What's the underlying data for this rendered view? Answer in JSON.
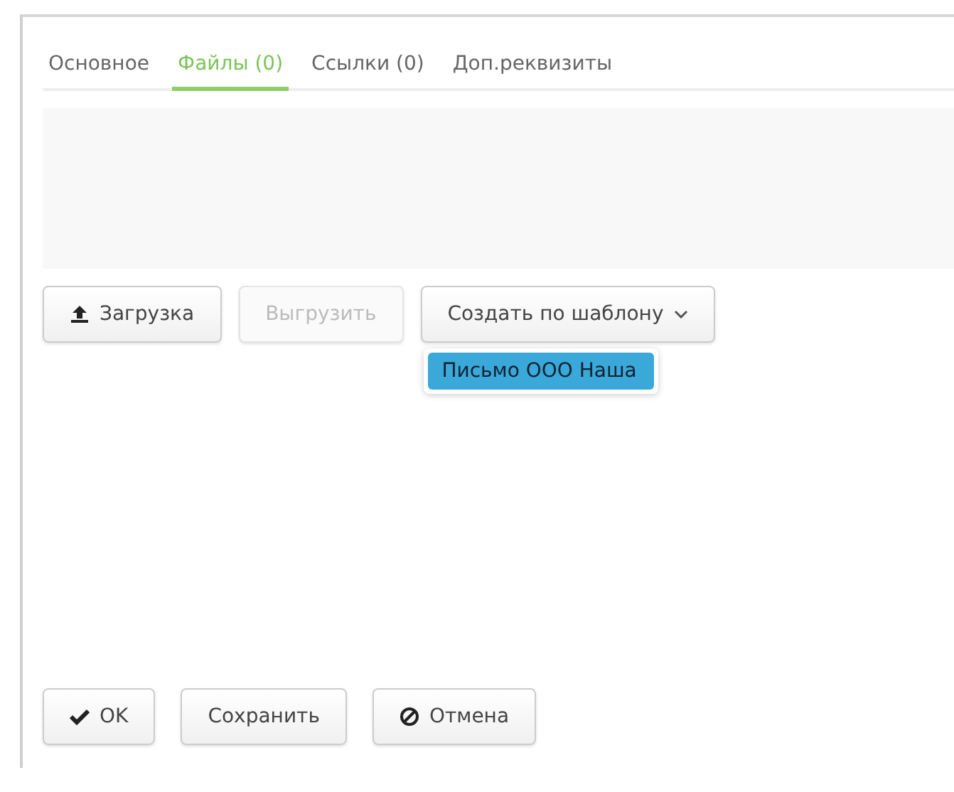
{
  "tabs": [
    {
      "label": "Основное",
      "selected": false
    },
    {
      "label": "Файлы (0)",
      "selected": true
    },
    {
      "label": "Ссылки (0)",
      "selected": false
    },
    {
      "label": "Доп.реквизиты",
      "selected": false
    }
  ],
  "toolbar": [
    {
      "label": "Загрузка",
      "kind": "upload",
      "disabled": false
    },
    {
      "label": "Выгрузить",
      "disabled": true
    },
    {
      "label": "Создать по шаблону",
      "kind": "dropdown",
      "disabled": false
    }
  ],
  "dropdown_menu": [
    {
      "label": "Письмо ООО Наша",
      "selected": true
    }
  ],
  "footer_buttons": [
    {
      "label": "OK",
      "kind": "ok"
    },
    {
      "label": "Сохранить"
    },
    {
      "label": "Отмена",
      "kind": "cancel"
    }
  ]
}
